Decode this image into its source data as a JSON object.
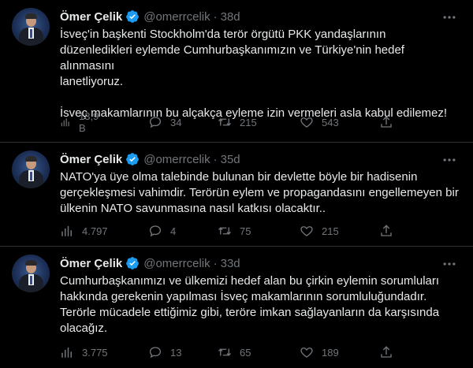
{
  "colors": {
    "background": "#000000",
    "text": "#e7e9ea",
    "muted": "#71767b",
    "verified": "#1d9bf0",
    "divider": "#2f3336"
  },
  "tweets": [
    {
      "name": "Ömer Çelik",
      "handle": "@omerrcelik",
      "separator": "·",
      "time": "38d",
      "lines": [
        "İsveç'in başkenti Stockholm'da terör örgütü PKK yandaşlarının",
        "düzenledikleri eylemde Cumhurbaşkanımızın ve Türkiye'nin hedef alınmasını",
        "lanetliyoruz.",
        "İsveç makamlarının bu alçakça eyleme izin vermeleri asla kabul edilemez!"
      ],
      "views": "13,9 B",
      "replies": "34",
      "retweets": "215",
      "likes": "543"
    },
    {
      "name": "Ömer Çelik",
      "handle": "@omerrcelik",
      "separator": "·",
      "time": "35d",
      "lines": [
        "NATO'ya üye olma talebinde bulunan bir devlette böyle bir hadisenin",
        "gerçekleşmesi vahimdir. Terörün eylem ve propagandasını engellemeyen bir",
        "ülkenin NATO savunmasına nasıl katkısı olacaktır.."
      ],
      "views": "4.797",
      "replies": "4",
      "retweets": "75",
      "likes": "215"
    },
    {
      "name": "Ömer Çelik",
      "handle": "@omerrcelik",
      "separator": "·",
      "time": "33d",
      "lines": [
        "Cumhurbaşkanımızı ve ülkemizi hedef alan bu çirkin eylemin sorumluları",
        "hakkında gerekenin yapılması İsveç makamlarının sorumluluğundadır.",
        "Terörle mücadele ettiğimiz gibi, teröre imkan sağlayanların da karşısında",
        "olacağız."
      ],
      "views": "3.775",
      "replies": "13",
      "retweets": "65",
      "likes": "189"
    }
  ]
}
